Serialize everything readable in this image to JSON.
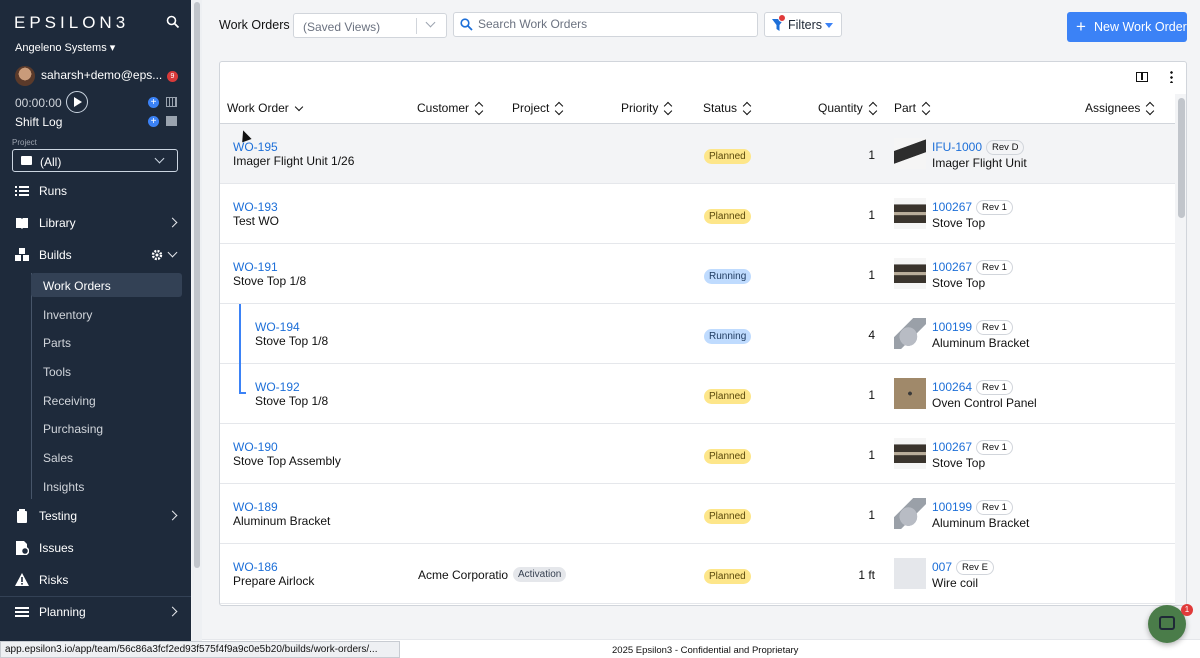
{
  "sidebar": {
    "logo": "EPSILON3",
    "org": "Angeleno Systems",
    "user": "saharsh+demo@eps...",
    "user_badge": "9",
    "timer": "00:00:00",
    "shift_log": "Shift Log",
    "project_label": "Project",
    "project_value": "(All)",
    "nav": {
      "runs": "Runs",
      "library": "Library",
      "builds": "Builds",
      "testing": "Testing",
      "issues": "Issues",
      "risks": "Risks",
      "planning": "Planning"
    },
    "builds_items": [
      "Work Orders",
      "Inventory",
      "Parts",
      "Tools",
      "Receiving",
      "Purchasing",
      "Sales",
      "Insights"
    ]
  },
  "header": {
    "title": "Work Orders",
    "saved_views": "(Saved Views)",
    "search_placeholder": "Search Work Orders",
    "filters": "Filters",
    "new_button": "New Work Order"
  },
  "table": {
    "columns": {
      "work_order": "Work Order",
      "customer": "Customer",
      "project": "Project",
      "priority": "Priority",
      "status": "Status",
      "quantity": "Quantity",
      "part": "Part",
      "assignees": "Assignees"
    },
    "rows": [
      {
        "id": "WO-195",
        "name": "Imager Flight Unit 1/26",
        "customer": "",
        "project": "",
        "status": "Planned",
        "qty": "1",
        "part_id": "IFU-1000",
        "rev": "Rev D",
        "part_name": "Imager Flight Unit"
      },
      {
        "id": "WO-193",
        "name": "Test WO",
        "customer": "",
        "project": "",
        "status": "Planned",
        "qty": "1",
        "part_id": "100267",
        "rev": "Rev 1",
        "part_name": "Stove Top"
      },
      {
        "id": "WO-191",
        "name": "Stove Top 1/8",
        "customer": "",
        "project": "",
        "status": "Running",
        "qty": "1",
        "part_id": "100267",
        "rev": "Rev 1",
        "part_name": "Stove Top"
      },
      {
        "id": "WO-194",
        "name": "Stove Top 1/8",
        "customer": "",
        "project": "",
        "status": "Running",
        "qty": "4",
        "part_id": "100199",
        "rev": "Rev 1",
        "part_name": "Aluminum Bracket"
      },
      {
        "id": "WO-192",
        "name": "Stove Top 1/8",
        "customer": "",
        "project": "",
        "status": "Planned",
        "qty": "1",
        "part_id": "100264",
        "rev": "Rev 1",
        "part_name": "Oven Control Panel"
      },
      {
        "id": "WO-190",
        "name": "Stove Top Assembly",
        "customer": "",
        "project": "",
        "status": "Planned",
        "qty": "1",
        "part_id": "100267",
        "rev": "Rev 1",
        "part_name": "Stove Top"
      },
      {
        "id": "WO-189",
        "name": "Aluminum Bracket",
        "customer": "",
        "project": "",
        "status": "Planned",
        "qty": "1",
        "part_id": "100199",
        "rev": "Rev 1",
        "part_name": "Aluminum Bracket"
      },
      {
        "id": "WO-186",
        "name": "Prepare Airlock",
        "customer": "Acme Corporation",
        "project": "Activation",
        "status": "Planned",
        "qty": "1 ft",
        "part_id": "007",
        "rev": "Rev E",
        "part_name": "Wire coil"
      }
    ]
  },
  "footer": {
    "text": "2025 Epsilon3 - Confidential and Proprietary",
    "status_url": "app.epsilon3.io/app/team/56c86a3fcf2ed93f575f4f9a9c0e5b20/builds/work-orders/...",
    "chat_badge": "1"
  }
}
